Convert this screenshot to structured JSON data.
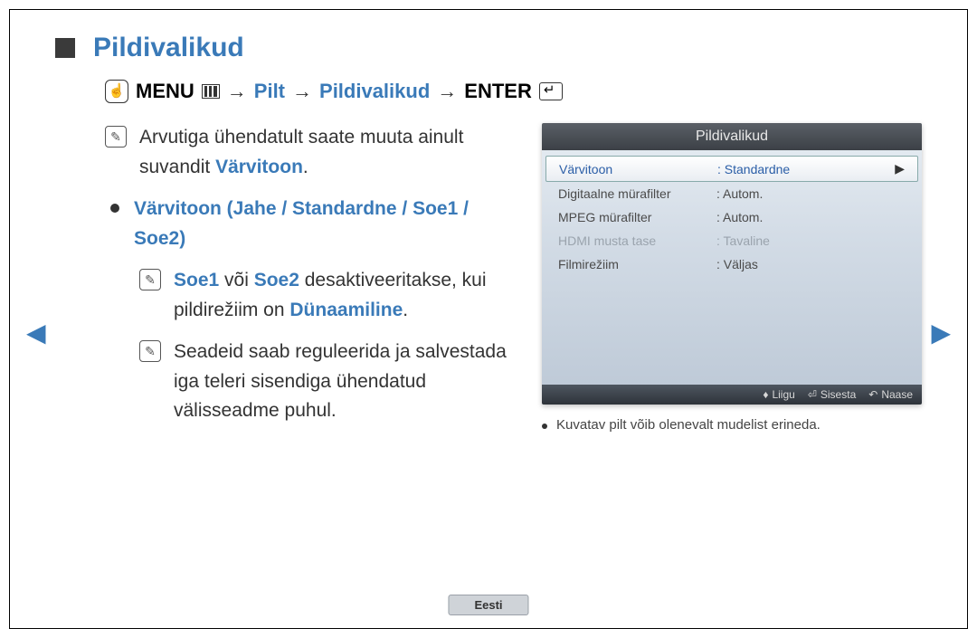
{
  "title": "Pildivalikud",
  "breadcrumb": {
    "menu": "MENU",
    "pilt": "Pilt",
    "pildivalikud": "Pildivalikud",
    "enter": "ENTER",
    "sep": "→"
  },
  "notes": {
    "n1a": "Arvutiga ühendatult saate muuta ainult suvandit ",
    "n1b": "Värvitoon",
    "n1c": ".",
    "bullet": "Värvitoon (Jahe / Standardne / Soe1 / Soe2)",
    "n2a": "Soe1",
    "n2b": " või ",
    "n2c": "Soe2",
    "n2d": " desaktiveeritakse, kui pildirežiim on ",
    "n2e": "Dünaamiline",
    "n2f": ".",
    "n3": "Seadeid saab reguleerida ja salvestada iga teleri sisendiga ühendatud välisseadme puhul."
  },
  "osd": {
    "title": "Pildivalikud",
    "rows": [
      {
        "label": "Värvitoon",
        "value": ": Standardne",
        "selected": true,
        "dim": false
      },
      {
        "label": "Digitaalne mürafilter",
        "value": ": Autom.",
        "selected": false,
        "dim": false
      },
      {
        "label": "MPEG mürafilter",
        "value": ": Autom.",
        "selected": false,
        "dim": false
      },
      {
        "label": "HDMI musta tase",
        "value": ": Tavaline",
        "selected": false,
        "dim": true
      },
      {
        "label": "Filmirežiim",
        "value": ": Väljas",
        "selected": false,
        "dim": false
      }
    ],
    "footer": {
      "move": "Liigu",
      "enter": "Sisesta",
      "return": "Naase"
    }
  },
  "caption": "Kuvatav pilt võib olenevalt mudelist erineda.",
  "lang": "Eesti",
  "nav": {
    "left": "◀",
    "right": "▶",
    "chev": "▶"
  }
}
